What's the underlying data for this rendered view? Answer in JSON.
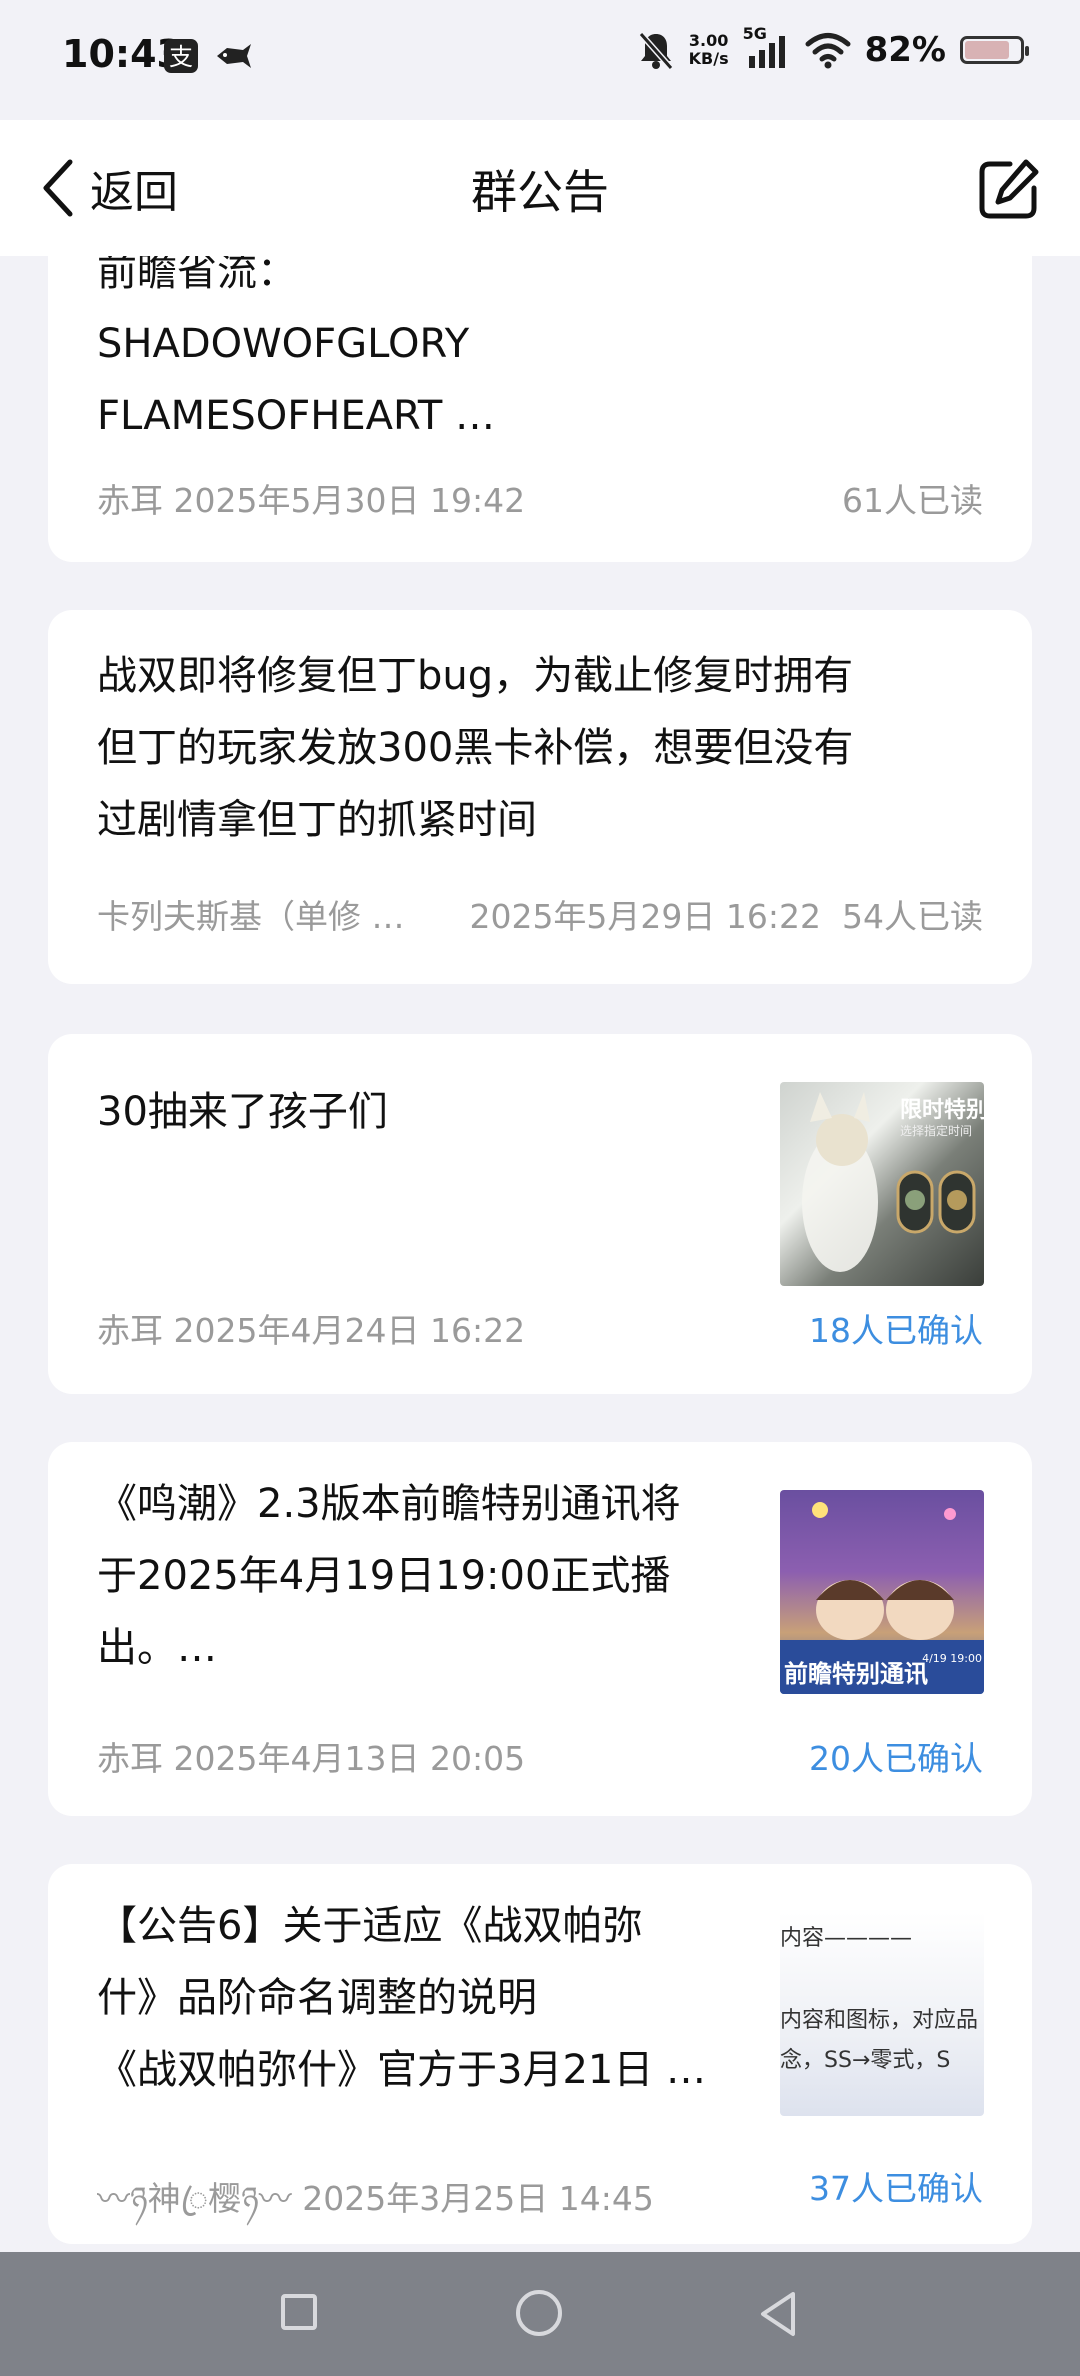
{
  "status": {
    "time": "10:43",
    "speed_top": "3.00",
    "speed_bottom": "KB/s",
    "network": "5G",
    "battery": "82%",
    "battery_level": 0.82
  },
  "nav": {
    "back_label": "返回",
    "title": "群公告"
  },
  "notices": [
    {
      "lines": [
        "前瞻省流：",
        "SHADOWOFGLORY",
        "FLAMESOFHEART …"
      ],
      "author": "赤耳",
      "date": "2025年5月30日 19:42",
      "status": "61人已读"
    },
    {
      "lines": [
        "战双即将修复但丁bug，为截止修复时拥有",
        "但丁的玩家发放300黑卡补偿，想要但没有",
        "过剧情拿但丁的抓紧时间"
      ],
      "author": "卡列夫斯基（单修 …",
      "date": "2025年5月29日 16:22",
      "status": "54人已读"
    },
    {
      "lines": [
        "30抽来了孩子们"
      ],
      "author": "赤耳",
      "date": "2025年4月24日 16:22",
      "status": "18人已确认",
      "thumb_text": [
        "限时特别",
        "选择指定时间"
      ]
    },
    {
      "lines": [
        "《鸣潮》2.3版本前瞻特别通讯将",
        "于2025年4月19日19:00正式播",
        "出。…"
      ],
      "author": "赤耳",
      "date": "2025年4月13日 20:05",
      "status": "20人已确认",
      "thumb_text": [
        "前瞻特别通讯",
        "4/19 19:00"
      ]
    },
    {
      "lines": [
        "【公告6】关于适应《战双帕弥",
        "什》品阶命名调整的说明",
        "《战双帕弥什》官方于3月21日 …"
      ],
      "author": "〰ཉ神ꦿ樱ཉ〰",
      "date": "2025年3月25日 14:45",
      "status": "37人已确认",
      "thumb_text": [
        "内容————",
        "内容和图标，对应品",
        "念，SS→零式，S"
      ]
    }
  ]
}
